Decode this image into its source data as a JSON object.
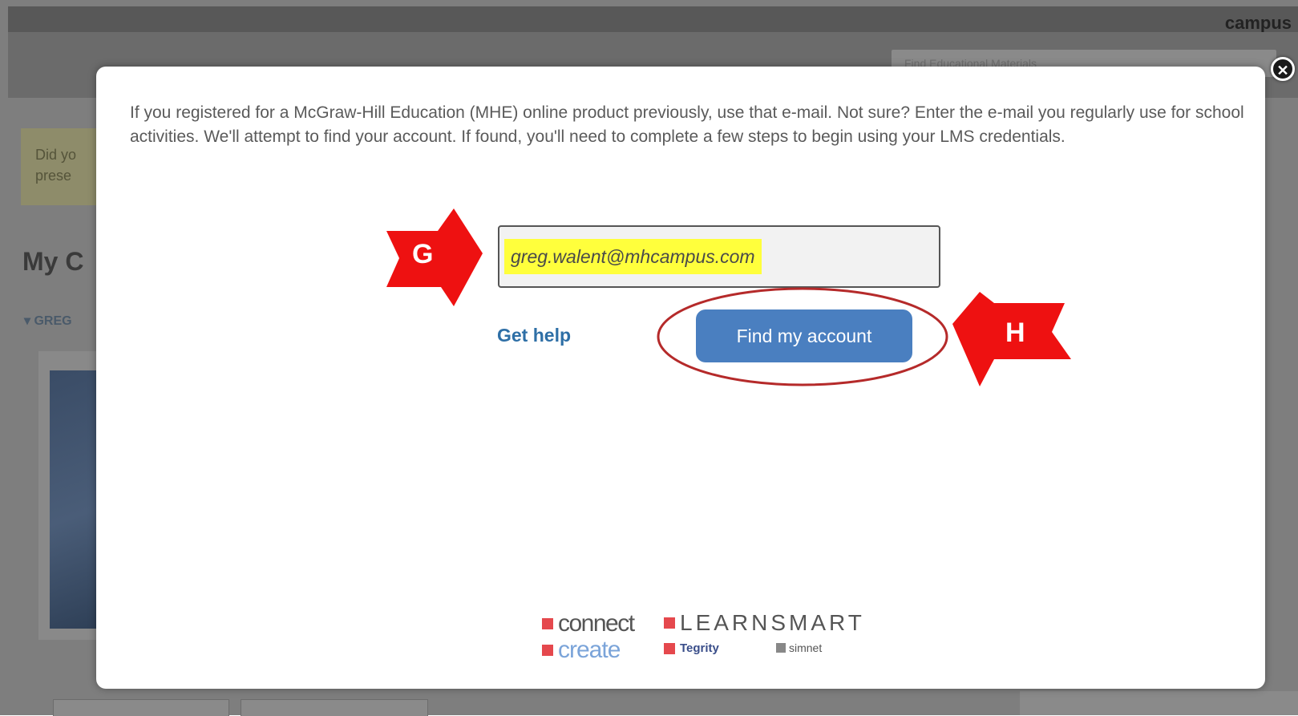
{
  "background": {
    "brand_text": "campus",
    "search_placeholder": "Find Educational Materials",
    "notice_line1": "Did yo",
    "notice_line2": "prese",
    "heading": "My C",
    "section_label": "GREG"
  },
  "modal": {
    "instructions": "If you registered for a McGraw-Hill Education (MHE) online product previously, use that e-mail. Not sure? Enter the e-mail you regularly use for school activities. We'll attempt to find your account. If found, you'll need to complete a few steps to begin using your LMS credentials.",
    "email_value": "greg.walent@mhcampus.com",
    "get_help_label": "Get help",
    "find_button_label": "Find my account",
    "close_symbol": "✕"
  },
  "annotations": {
    "arrow_g_label": "G",
    "arrow_h_label": "H",
    "arrow_color": "#ee1111",
    "circle_color": "#b52a2a"
  },
  "logos": {
    "connect": "connect",
    "learnsmart": "LEARNSMART",
    "create": "create",
    "tegrity": "Tegrity",
    "simnet": "simnet"
  },
  "colors": {
    "accent_button": "#4a7fc0",
    "link": "#2e6fa6",
    "highlight": "#ffff3c",
    "logo_red": "#e5484d"
  }
}
